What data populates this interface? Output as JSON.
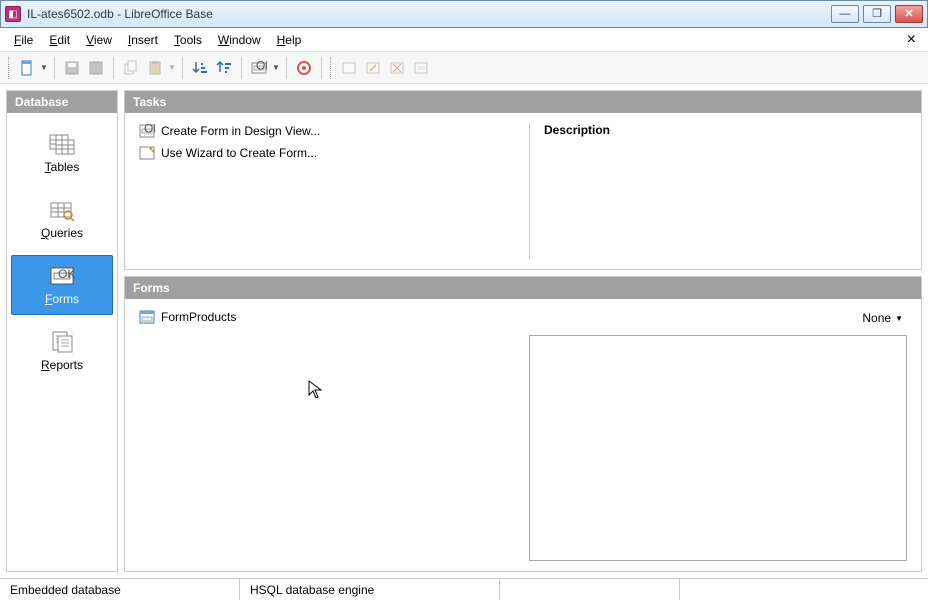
{
  "title": "IL-ates6502.odb - LibreOffice Base",
  "menus": {
    "file": "File",
    "edit": "Edit",
    "view": "View",
    "insert": "Insert",
    "tools": "Tools",
    "window": "Window",
    "help": "Help"
  },
  "sidebar": {
    "header": "Database",
    "items": [
      {
        "label": "Tables",
        "underline": "T"
      },
      {
        "label": "Queries",
        "underline": "Q"
      },
      {
        "label": "Forms",
        "underline": "F",
        "selected": true
      },
      {
        "label": "Reports",
        "underline": "R"
      }
    ]
  },
  "tasks": {
    "header": "Tasks",
    "items": [
      "Create Form in Design View...",
      "Use Wizard to Create Form..."
    ],
    "descriptionLabel": "Description"
  },
  "formsSection": {
    "header": "Forms",
    "items": [
      "FormProducts"
    ],
    "previewMode": "None"
  },
  "status": {
    "left": "Embedded database",
    "engine": "HSQL database engine"
  }
}
